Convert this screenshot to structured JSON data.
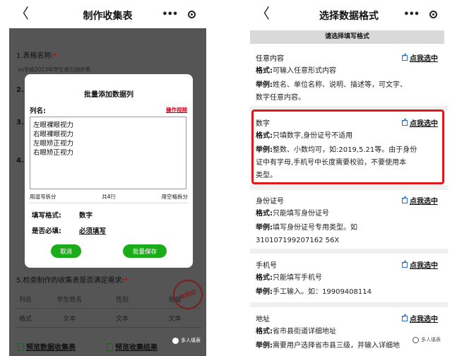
{
  "left": {
    "header": {
      "back_glyph": "〈",
      "title": "制作收集表"
    },
    "bg": {
      "q1_label": "1.表格名称:",
      "q1_req": "*",
      "q1_value": "xx学校2023年学生视力测评表",
      "q2_num": "2.",
      "q3_num": "3.",
      "q4_num": "4.",
      "q5_label": "5.检查制作的收集表是否满足需求:",
      "q5_req": "*"
    },
    "table": {
      "headers": [
        "列名",
        "学生姓名",
        "性别",
        "班级"
      ],
      "row": [
        "格式",
        "文本",
        "文本",
        "文本"
      ]
    },
    "stamp_text": "有效印",
    "footer": {
      "preview_link": "预览数据收集表",
      "preview_link2": "预览收集结果"
    },
    "watermark": "多人填表",
    "modal": {
      "title": "批量添加数据列",
      "col_label": "列名:",
      "video_link": "操作视频",
      "textarea_lines": [
        "左眼裸眼视力",
        "右眼裸眼视力",
        "左眼矫正视力",
        "右眼矫正视力"
      ],
      "split_comma": "用逗号拆分",
      "line_count": "共4行",
      "split_space": "用空格拆分",
      "format_label": "填写格式:",
      "format_value": "数字",
      "required_label": "是否必填:",
      "required_value": "必须填写",
      "cancel_button": "取消",
      "save_button": "批量保存"
    }
  },
  "right": {
    "header": {
      "back_glyph": "〈",
      "title": "选择数据格式"
    },
    "banner": "请选择填写格式",
    "pick_label": "点我选中",
    "format_prefix": "格式:",
    "example_prefix": "举例:",
    "items": [
      {
        "name": "任意内容",
        "format": "可输入任意形式内容",
        "example_lines": [
          "姓名、单位名称、说明、描述等，可文字、",
          "数字任意内容。"
        ]
      },
      {
        "name": "数字",
        "format": "只填数字,身份证号不适用",
        "example_lines": [
          "整数、小数均可，如:2019,5.21等。由于身份",
          "证中有字母,手机号中长度需要校验，不要使用本",
          "类型。"
        ]
      },
      {
        "name": "身份证号",
        "format": "只能填写身份证号",
        "example_lines": [
          "填写身份证号专用类型。如",
          "310107199207162 56X"
        ]
      },
      {
        "name": "手机号",
        "format": "只能填写手机号",
        "example_lines": [
          "手工输入。如：19909408114"
        ]
      },
      {
        "name": "地址",
        "format": "省市县街道详细地址",
        "example_lines": [
          "需要用户选择省市县三级，并输入详细地"
        ]
      }
    ],
    "watermark": "多人填表"
  }
}
